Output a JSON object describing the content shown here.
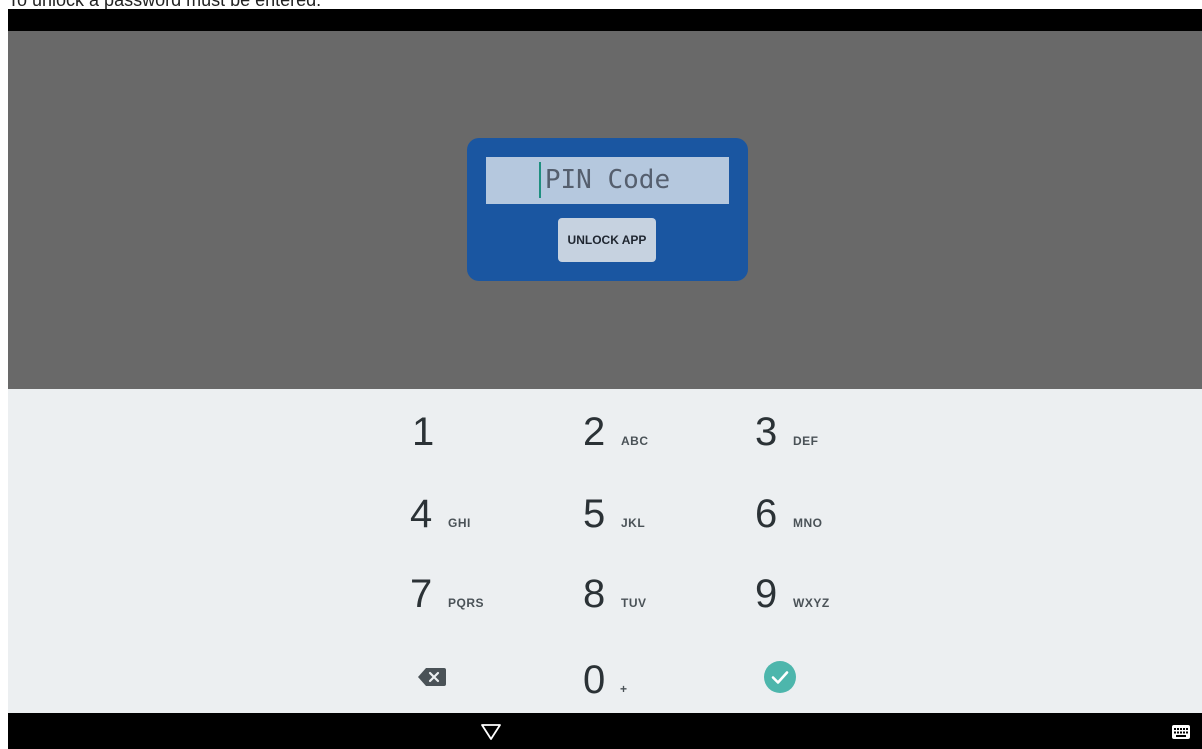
{
  "caption": "To unlock a password must be entered.",
  "dialog": {
    "pin_placeholder": "PIN Code",
    "unlock_label": "UNLOCK APP"
  },
  "keyboard": {
    "keys": [
      {
        "digit": "1",
        "letters": ""
      },
      {
        "digit": "2",
        "letters": "ABC"
      },
      {
        "digit": "3",
        "letters": "DEF"
      },
      {
        "digit": "4",
        "letters": "GHI"
      },
      {
        "digit": "5",
        "letters": "JKL"
      },
      {
        "digit": "6",
        "letters": "MNO"
      },
      {
        "digit": "7",
        "letters": "PQRS"
      },
      {
        "digit": "8",
        "letters": "TUV"
      },
      {
        "digit": "9",
        "letters": "WXYZ"
      },
      {
        "digit": "0",
        "letters": "+"
      }
    ],
    "backspace_icon": "backspace-icon",
    "done_icon": "check-icon",
    "done_color": "#4db6ac"
  },
  "nav": {
    "back_icon": "back-triangle-icon",
    "keyboard_icon": "keyboard-icon"
  },
  "colors": {
    "dialog_bg": "#1a56a1",
    "input_bg": "#b5c8de",
    "app_bg": "#696969",
    "keyboard_bg": "#eceff1"
  }
}
